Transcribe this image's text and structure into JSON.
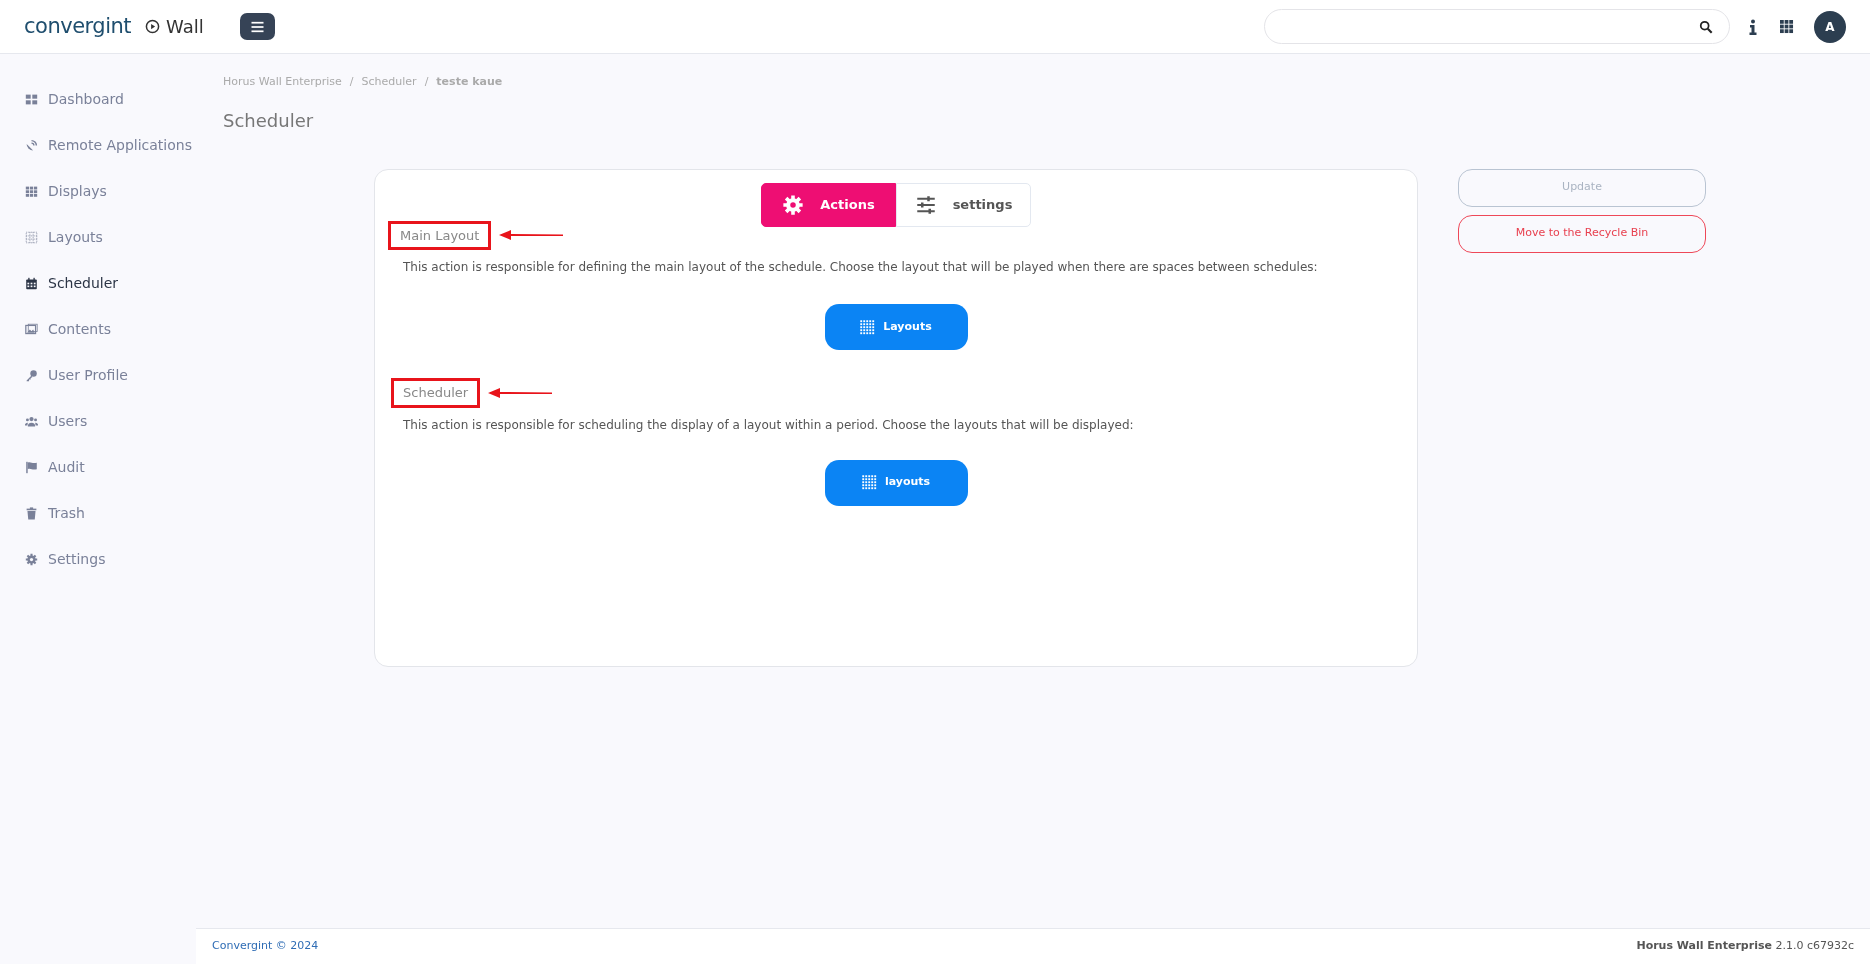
{
  "header": {
    "logo": "convergint",
    "app_name": "Wall",
    "avatar": "A"
  },
  "sidebar": {
    "items": [
      {
        "label": "Dashboard",
        "selected": false
      },
      {
        "label": "Remote Applications",
        "selected": false
      },
      {
        "label": "Displays",
        "selected": false
      },
      {
        "label": "Layouts",
        "selected": false
      },
      {
        "label": "Scheduler",
        "selected": true
      },
      {
        "label": "Contents",
        "selected": false
      },
      {
        "label": "User Profile",
        "selected": false
      },
      {
        "label": "Users",
        "selected": false
      },
      {
        "label": "Audit",
        "selected": false
      },
      {
        "label": "Trash",
        "selected": false
      },
      {
        "label": "Settings",
        "selected": false
      }
    ]
  },
  "breadcrumb": [
    {
      "kind": "link",
      "label": "Horus Wall Enterprise"
    },
    {
      "kind": "separator",
      "label": "/"
    },
    {
      "kind": "link",
      "label": "Scheduler"
    },
    {
      "kind": "separator",
      "label": "/"
    },
    {
      "kind": "current",
      "label": "teste kaue"
    }
  ],
  "page_title": "Scheduler",
  "tabs": [
    {
      "label": "Actions",
      "selected": true
    },
    {
      "label": "settings",
      "selected": false
    }
  ],
  "sections": [
    {
      "title": "Main Layout",
      "description": "This action is responsible for defining the main layout of the schedule. Choose the layout that will be played when there are spaces between schedules:",
      "button": "Layouts"
    },
    {
      "title": "Scheduler",
      "description": "This action is responsible for scheduling the display of a layout within a period. Choose the layouts that will be displayed:",
      "button": "layouts"
    }
  ],
  "side_buttons": [
    {
      "label": "Update",
      "kind": "update"
    },
    {
      "label": "Move to the Recycle Bin",
      "kind": "danger"
    }
  ],
  "footer": {
    "left": "Convergint © 2024",
    "right": "**Horus Wall Enterprise** 2.1.0 c67932c"
  }
}
